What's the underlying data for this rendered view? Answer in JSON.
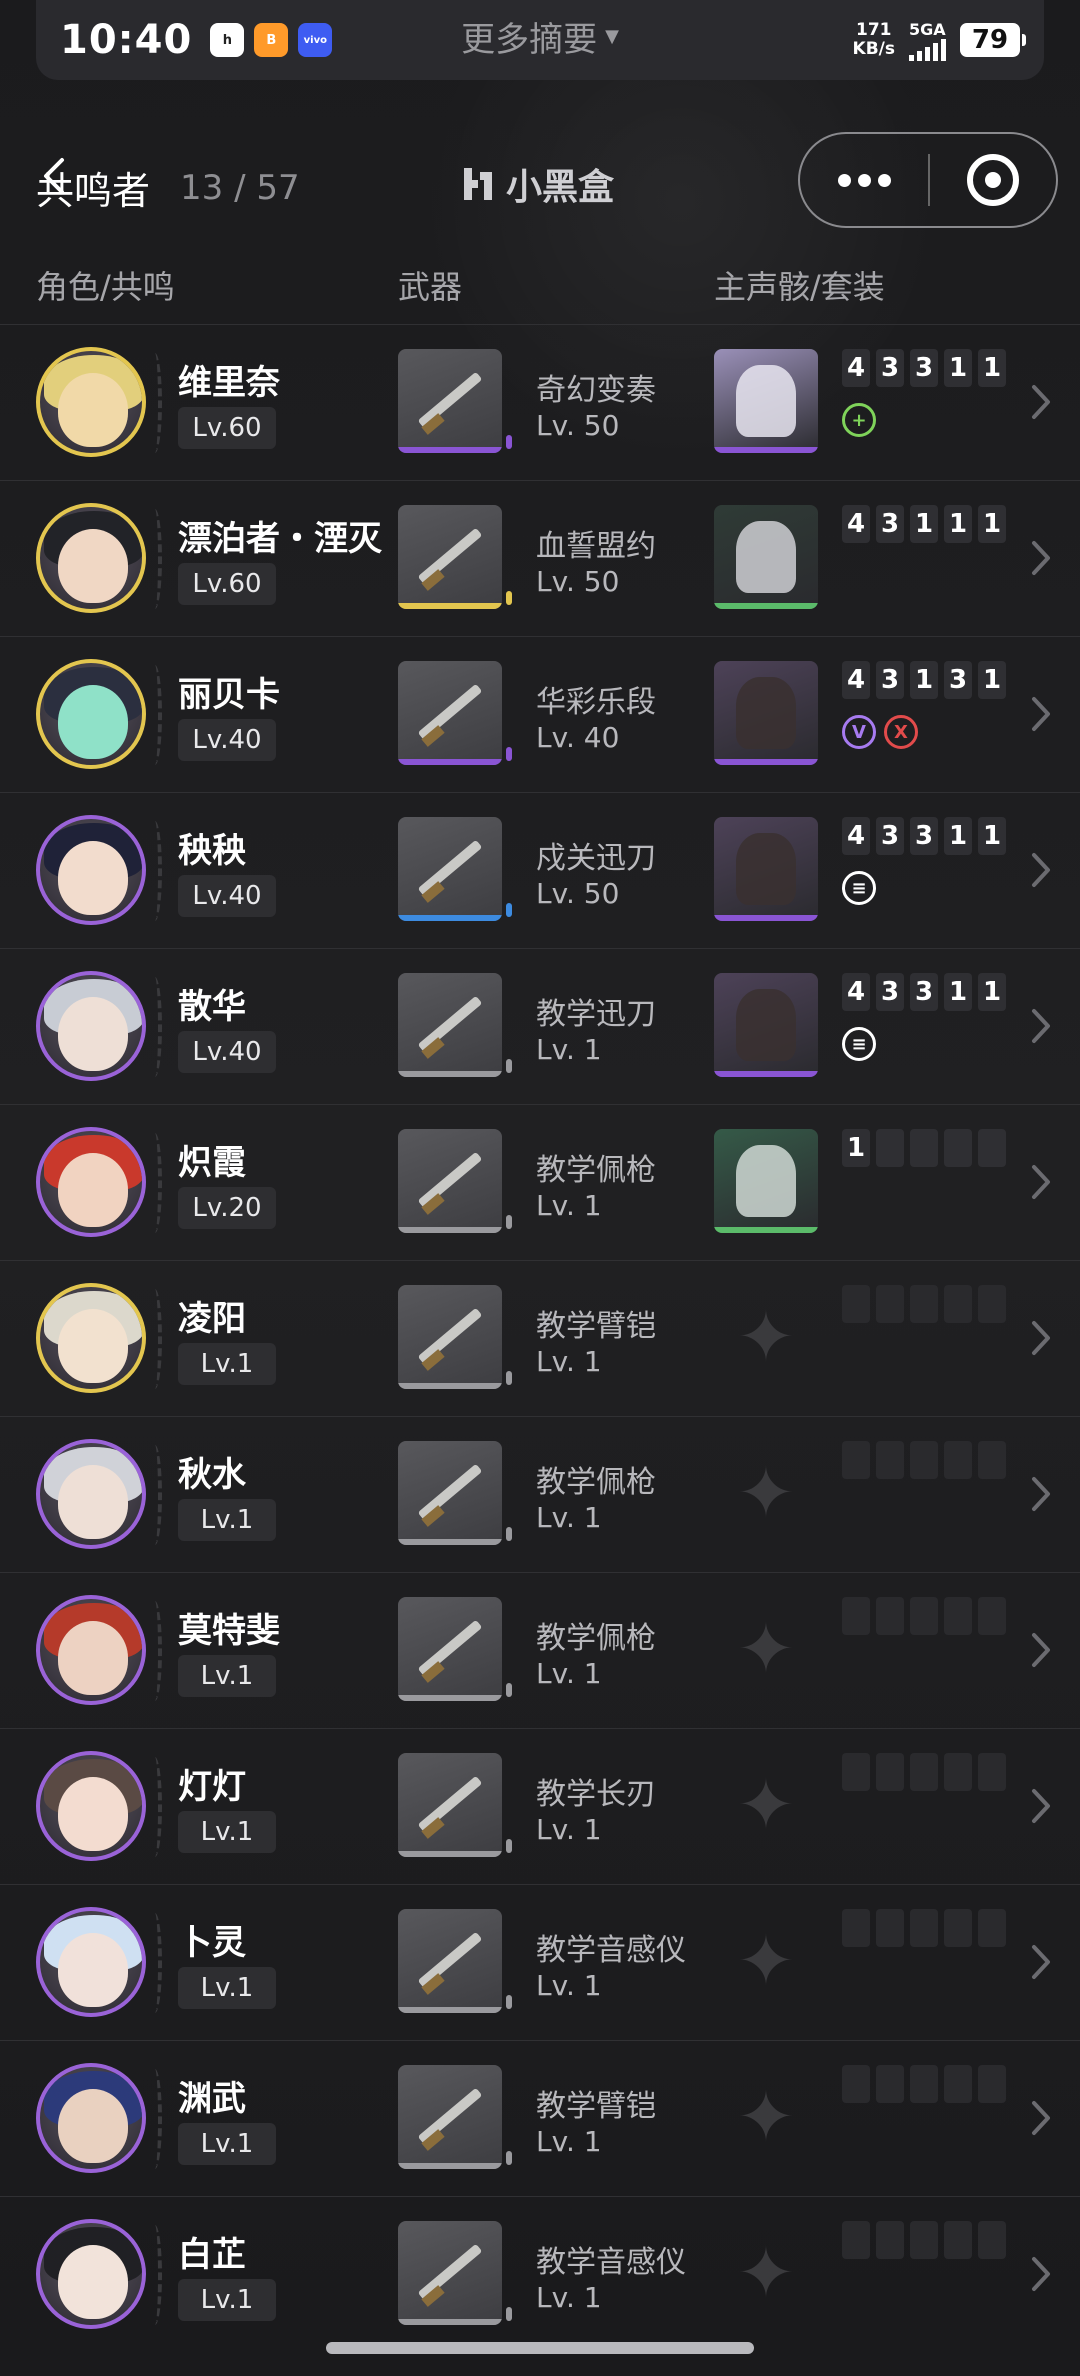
{
  "status_bar": {
    "time": "10:40",
    "center": "更多摘要",
    "net_speed": "171",
    "net_unit": "KB/s",
    "signal_type": "5GA",
    "battery": "79",
    "apps": [
      {
        "label": "h",
        "style": "white"
      },
      {
        "label": "B",
        "style": "orange"
      },
      {
        "label": "vivo",
        "style": "blue"
      }
    ]
  },
  "header": {
    "title": "共鸣者",
    "count": "13 / 57",
    "brand": "小黑盒"
  },
  "columns": {
    "role": "角色/共鸣",
    "weapon": "武器",
    "echo": "主声骸/套装"
  },
  "rows": [
    {
      "name": "维里奈",
      "level": "Lv.60",
      "ring": "gold",
      "face": "#f1d9a8",
      "hair": "#e2cf7c",
      "weapon": {
        "name": "奇幻变奏",
        "level": "Lv. 50",
        "rarity": "#8a55d4"
      },
      "echo": {
        "bg": "#9a90b8",
        "shape": "#e8e5f0",
        "bar": "#8a55d4",
        "costs": [
          "4",
          "3",
          "3",
          "1",
          "1"
        ],
        "sets": [
          {
            "glyph": "+",
            "color": "#7fd35a"
          }
        ]
      }
    },
    {
      "name": "漂泊者・湮灭",
      "level": "Lv.60",
      "ring": "gold",
      "face": "#f0d7c4",
      "hair": "#222328",
      "weapon": {
        "name": "血誓盟约",
        "level": "Lv. 50",
        "rarity": "#e3c64f"
      },
      "echo": {
        "bg": "#2f3b36",
        "shape": "#cfcfd3",
        "bar": "#5bbb6a",
        "costs": [
          "4",
          "3",
          "1",
          "1",
          "1"
        ],
        "sets": []
      }
    },
    {
      "name": "丽贝卡",
      "level": "Lv.40",
      "ring": "gold",
      "face": "#8fe1c8",
      "hair": "#2b2f3f",
      "weapon": {
        "name": "华彩乐段",
        "level": "Lv. 40",
        "rarity": "#8a55d4"
      },
      "echo": {
        "bg": "#4d4258",
        "shape": "#3a3030",
        "bar": "#8a55d4",
        "costs": [
          "4",
          "3",
          "1",
          "3",
          "1"
        ],
        "sets": [
          {
            "glyph": "V",
            "color": "#a77bf0"
          },
          {
            "glyph": "X",
            "color": "#e24b4b"
          }
        ]
      }
    },
    {
      "name": "秧秧",
      "level": "Lv.40",
      "ring": "purple",
      "face": "#f2dccd",
      "hair": "#1f2238",
      "weapon": {
        "name": "戍关迅刀",
        "level": "Lv. 50",
        "rarity": "#3d8be0"
      },
      "echo": {
        "bg": "#4d4258",
        "shape": "#3a3030",
        "bar": "#8a55d4",
        "costs": [
          "4",
          "3",
          "3",
          "1",
          "1"
        ],
        "sets": [
          {
            "glyph": "≡",
            "color": "#ffffff"
          }
        ]
      }
    },
    {
      "name": "散华",
      "level": "Lv.40",
      "ring": "purple",
      "face": "#eedfd6",
      "hair": "#c8ccd4",
      "weapon": {
        "name": "教学迅刀",
        "level": "Lv. 1",
        "rarity": "#9a9a9e"
      },
      "echo": {
        "bg": "#4d4258",
        "shape": "#3a3030",
        "bar": "#8a55d4",
        "costs": [
          "4",
          "3",
          "3",
          "1",
          "1"
        ],
        "sets": [
          {
            "glyph": "≡",
            "color": "#ffffff"
          }
        ]
      }
    },
    {
      "name": "炽霞",
      "level": "Lv.20",
      "ring": "purple",
      "face": "#f1d3c1",
      "hair": "#c9392c",
      "weapon": {
        "name": "教学佩枪",
        "level": "Lv. 1",
        "rarity": "#9a9a9e"
      },
      "echo": {
        "bg": "#355a48",
        "shape": "#cfd8d4",
        "bar": "#5bbb6a",
        "costs": [
          "1",
          "",
          "",
          "",
          ""
        ],
        "sets": []
      }
    },
    {
      "name": "凌阳",
      "level": "Lv.1",
      "ring": "gold",
      "face": "#f2e1cf",
      "hair": "#dcd8cc",
      "weapon": {
        "name": "教学臂铠",
        "level": "Lv. 1",
        "rarity": "#9a9a9e"
      },
      "echo": null
    },
    {
      "name": "秋水",
      "level": "Lv.1",
      "ring": "purple",
      "face": "#eedfd6",
      "hair": "#d0d2d8",
      "weapon": {
        "name": "教学佩枪",
        "level": "Lv. 1",
        "rarity": "#9a9a9e"
      },
      "echo": null
    },
    {
      "name": "莫特斐",
      "level": "Lv.1",
      "ring": "purple",
      "face": "#edd2c2",
      "hair": "#b53a2a",
      "weapon": {
        "name": "教学佩枪",
        "level": "Lv. 1",
        "rarity": "#9a9a9e"
      },
      "echo": null
    },
    {
      "name": "灯灯",
      "level": "Lv.1",
      "ring": "purple",
      "face": "#f3dcd0",
      "hair": "#5a4a44",
      "weapon": {
        "name": "教学长刃",
        "level": "Lv. 1",
        "rarity": "#9a9a9e"
      },
      "echo": null
    },
    {
      "name": "卜灵",
      "level": "Lv.1",
      "ring": "purple",
      "face": "#f1e1da",
      "hair": "#cfe0f2",
      "weapon": {
        "name": "教学音感仪",
        "level": "Lv. 1",
        "rarity": "#9a9a9e"
      },
      "echo": null
    },
    {
      "name": "渊武",
      "level": "Lv.1",
      "ring": "purple",
      "face": "#e9d1c0",
      "hair": "#2c3a7a",
      "weapon": {
        "name": "教学臂铠",
        "level": "Lv. 1",
        "rarity": "#9a9a9e"
      },
      "echo": null
    },
    {
      "name": "白芷",
      "level": "Lv.1",
      "ring": "purple",
      "face": "#f2e3da",
      "hair": "#202024",
      "weapon": {
        "name": "教学音感仪",
        "level": "Lv. 1",
        "rarity": "#9a9a9e"
      },
      "echo": null
    }
  ]
}
